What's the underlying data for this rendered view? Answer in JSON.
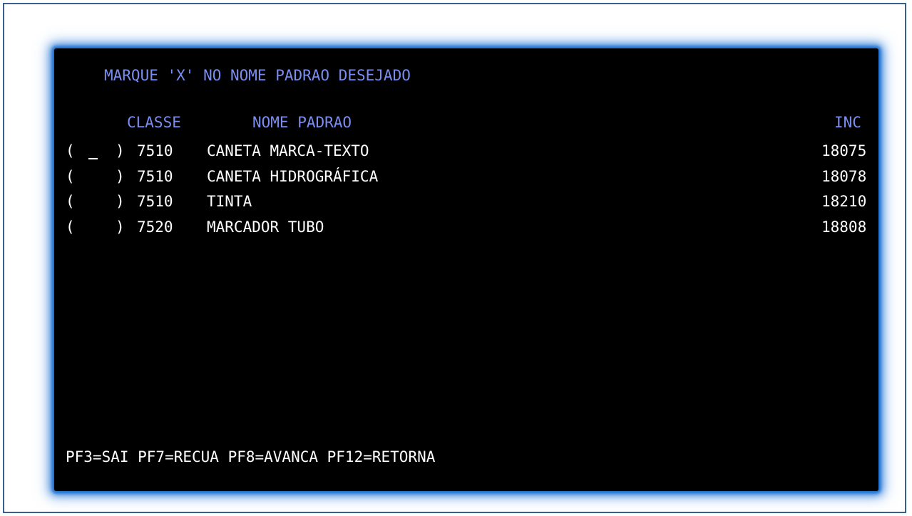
{
  "screen": {
    "title": "MARQUE 'X' NO NOME PADRAO DESEJADO",
    "headers": {
      "classe": "CLASSE",
      "nome_padrao": "NOME PADRAO",
      "inc": "INC"
    },
    "rows": [
      {
        "open": "(",
        "selection": "",
        "close": ")",
        "classe": "7510",
        "nome": "CANETA MARCA-TEXTO",
        "inc": "18075"
      },
      {
        "open": "(",
        "selection": "",
        "close": ")",
        "classe": "7510",
        "nome": "CANETA HIDROGRÁFICA",
        "inc": "18078"
      },
      {
        "open": "(",
        "selection": "",
        "close": ")",
        "classe": "7510",
        "nome": "TINTA",
        "inc": "18210"
      },
      {
        "open": "(",
        "selection": "",
        "close": ")",
        "classe": "7520",
        "nome": "MARCADOR TUBO",
        "inc": "18808"
      }
    ],
    "function_keys": "PF3=SAI PF7=RECUA PF8=AVANCA PF12=RETORNA"
  },
  "colors": {
    "label_blue": "#7b8ef0",
    "text_white": "#ffffff",
    "background": "#000000",
    "glow": "#1a6fd1"
  }
}
